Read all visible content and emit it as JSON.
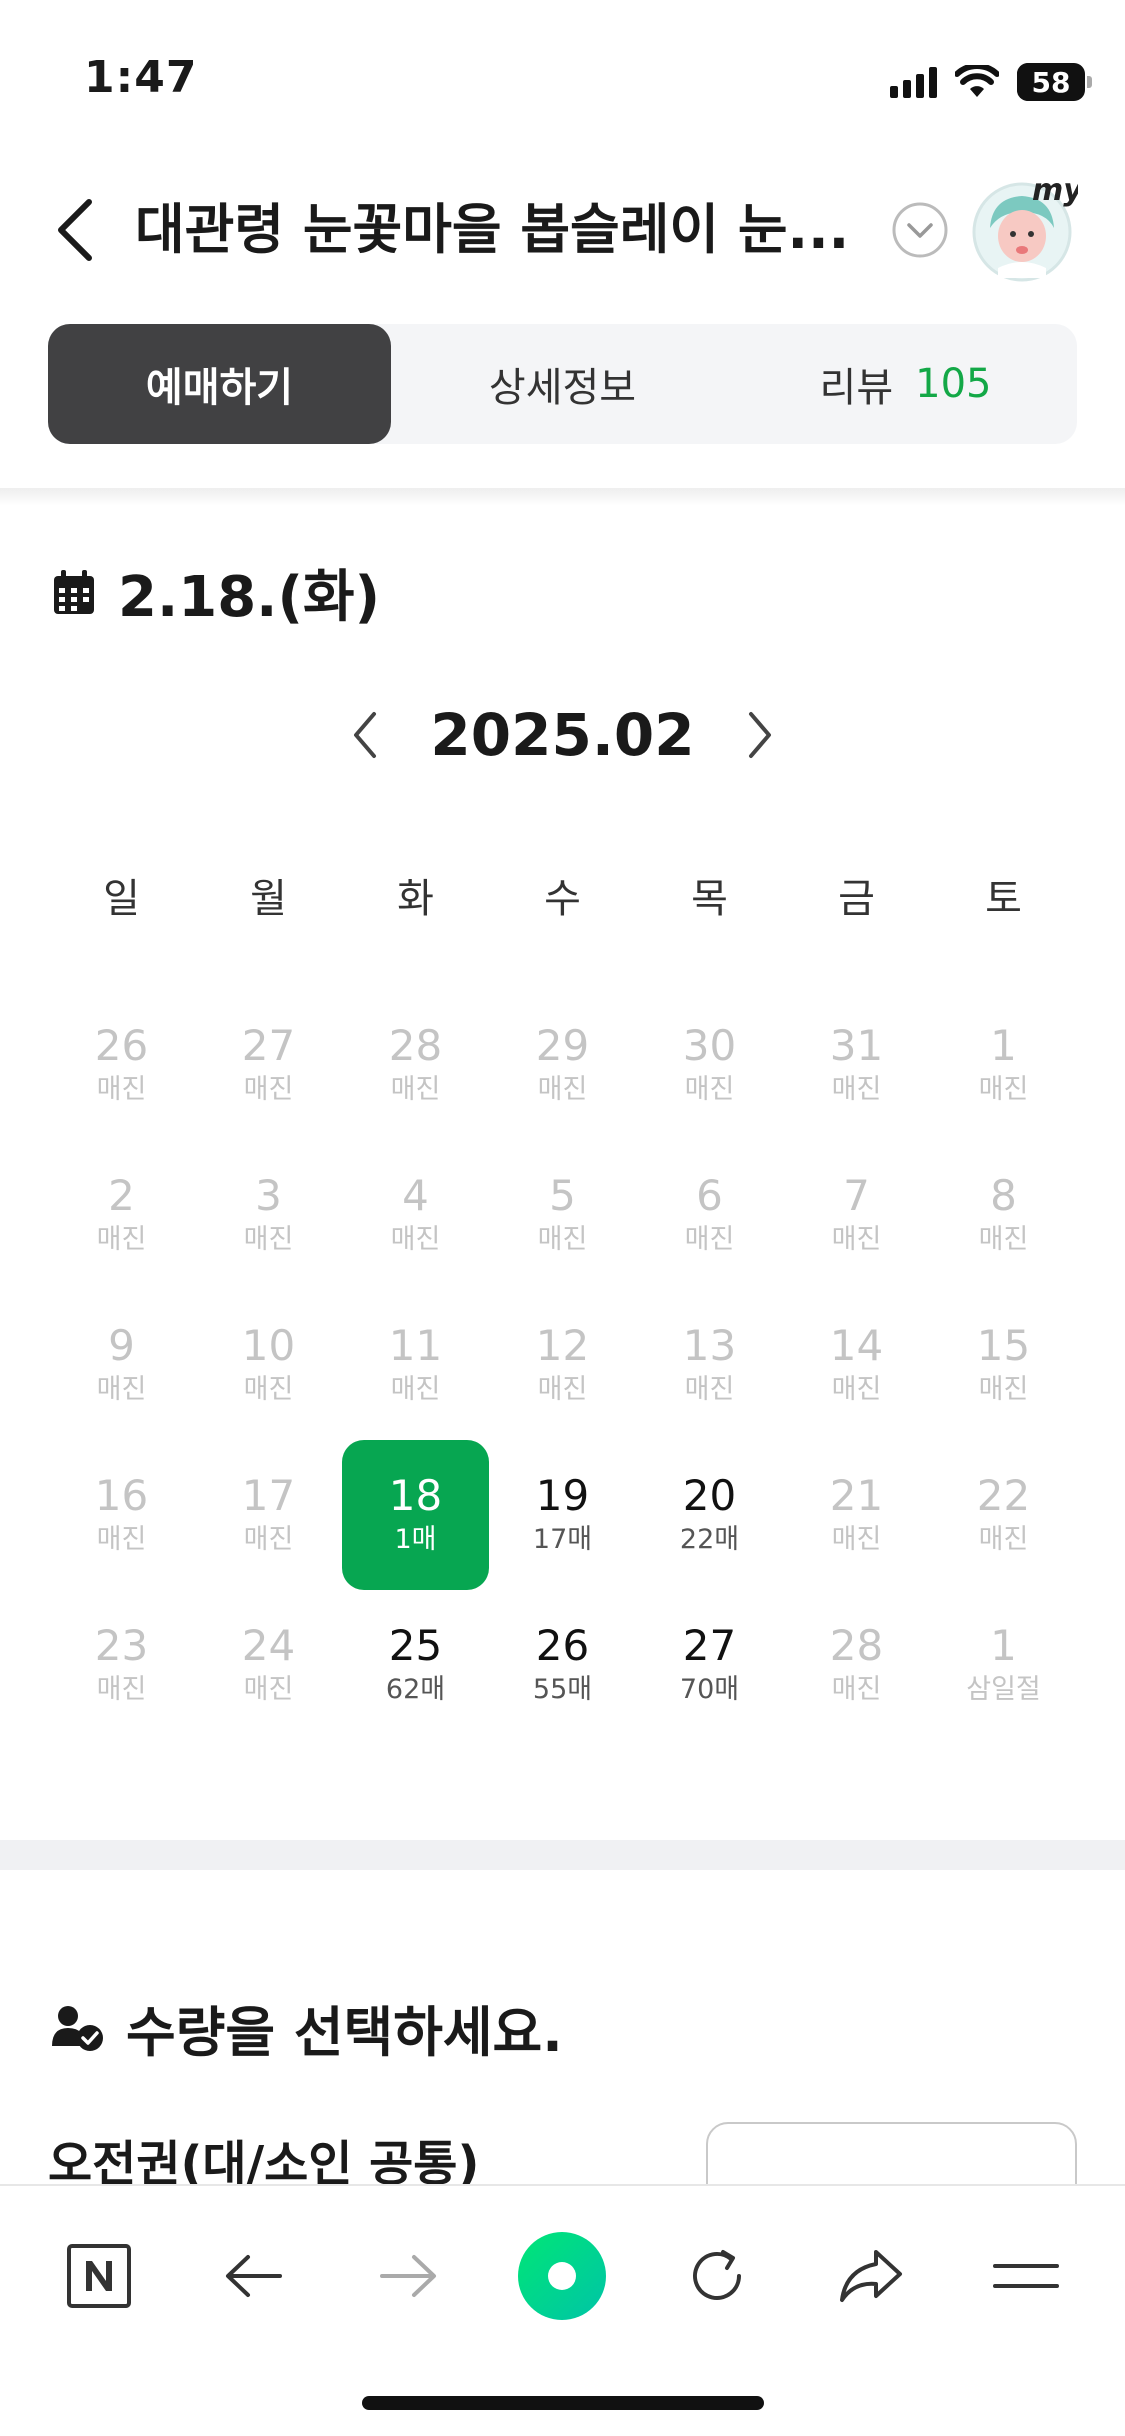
{
  "status": {
    "time": "1:47",
    "battery": "58",
    "battery_fraction": 0.58
  },
  "header": {
    "title": "대관령 눈꽃마을 봅슬레이 눈..."
  },
  "tabs": [
    {
      "label": "예매하기",
      "active": true
    },
    {
      "label": "상세정보",
      "active": false
    },
    {
      "label": "리뷰",
      "count": "105",
      "active": false
    }
  ],
  "selected_date": "2.18.(화)",
  "calendar": {
    "month": "2025.02",
    "weekdays": [
      "일",
      "월",
      "화",
      "수",
      "목",
      "금",
      "토"
    ],
    "weeks": [
      [
        {
          "num": "26",
          "sub": "매진",
          "state": "disabled"
        },
        {
          "num": "27",
          "sub": "매진",
          "state": "disabled"
        },
        {
          "num": "28",
          "sub": "매진",
          "state": "disabled"
        },
        {
          "num": "29",
          "sub": "매진",
          "state": "disabled"
        },
        {
          "num": "30",
          "sub": "매진",
          "state": "disabled"
        },
        {
          "num": "31",
          "sub": "매진",
          "state": "disabled"
        },
        {
          "num": "1",
          "sub": "매진",
          "state": "disabled"
        }
      ],
      [
        {
          "num": "2",
          "sub": "매진",
          "state": "disabled"
        },
        {
          "num": "3",
          "sub": "매진",
          "state": "disabled"
        },
        {
          "num": "4",
          "sub": "매진",
          "state": "disabled"
        },
        {
          "num": "5",
          "sub": "매진",
          "state": "disabled"
        },
        {
          "num": "6",
          "sub": "매진",
          "state": "disabled"
        },
        {
          "num": "7",
          "sub": "매진",
          "state": "disabled"
        },
        {
          "num": "8",
          "sub": "매진",
          "state": "disabled"
        }
      ],
      [
        {
          "num": "9",
          "sub": "매진",
          "state": "disabled"
        },
        {
          "num": "10",
          "sub": "매진",
          "state": "disabled"
        },
        {
          "num": "11",
          "sub": "매진",
          "state": "disabled"
        },
        {
          "num": "12",
          "sub": "매진",
          "state": "disabled"
        },
        {
          "num": "13",
          "sub": "매진",
          "state": "disabled"
        },
        {
          "num": "14",
          "sub": "매진",
          "state": "disabled"
        },
        {
          "num": "15",
          "sub": "매진",
          "state": "disabled"
        }
      ],
      [
        {
          "num": "16",
          "sub": "매진",
          "state": "disabled"
        },
        {
          "num": "17",
          "sub": "매진",
          "state": "disabled"
        },
        {
          "num": "18",
          "sub": "1매",
          "state": "selected"
        },
        {
          "num": "19",
          "sub": "17매",
          "state": "avail"
        },
        {
          "num": "20",
          "sub": "22매",
          "state": "avail"
        },
        {
          "num": "21",
          "sub": "매진",
          "state": "disabled"
        },
        {
          "num": "22",
          "sub": "매진",
          "state": "disabled"
        }
      ],
      [
        {
          "num": "23",
          "sub": "매진",
          "state": "disabled"
        },
        {
          "num": "24",
          "sub": "매진",
          "state": "disabled"
        },
        {
          "num": "25",
          "sub": "62매",
          "state": "avail"
        },
        {
          "num": "26",
          "sub": "55매",
          "state": "avail"
        },
        {
          "num": "27",
          "sub": "70매",
          "state": "avail"
        },
        {
          "num": "28",
          "sub": "매진",
          "state": "disabled"
        },
        {
          "num": "1",
          "sub": "삼일절",
          "state": "disabled"
        }
      ]
    ]
  },
  "quantity": {
    "heading": "수량을 선택하세요.",
    "ticket_name": "오전권(대/소인 공통)"
  },
  "colors": {
    "accent": "#07a651",
    "tab_active": "#414143",
    "review_count": "#13a847",
    "browser_home": "#00d26a"
  },
  "icons": [
    "back-arrow-icon",
    "chevron-down-circle-icon",
    "my-avatar-icon",
    "calendar-icon",
    "person-check-icon",
    "naver-n-icon",
    "nav-back-icon",
    "nav-forward-icon",
    "home-circle-icon",
    "refresh-icon",
    "share-icon",
    "menu-icon"
  ]
}
